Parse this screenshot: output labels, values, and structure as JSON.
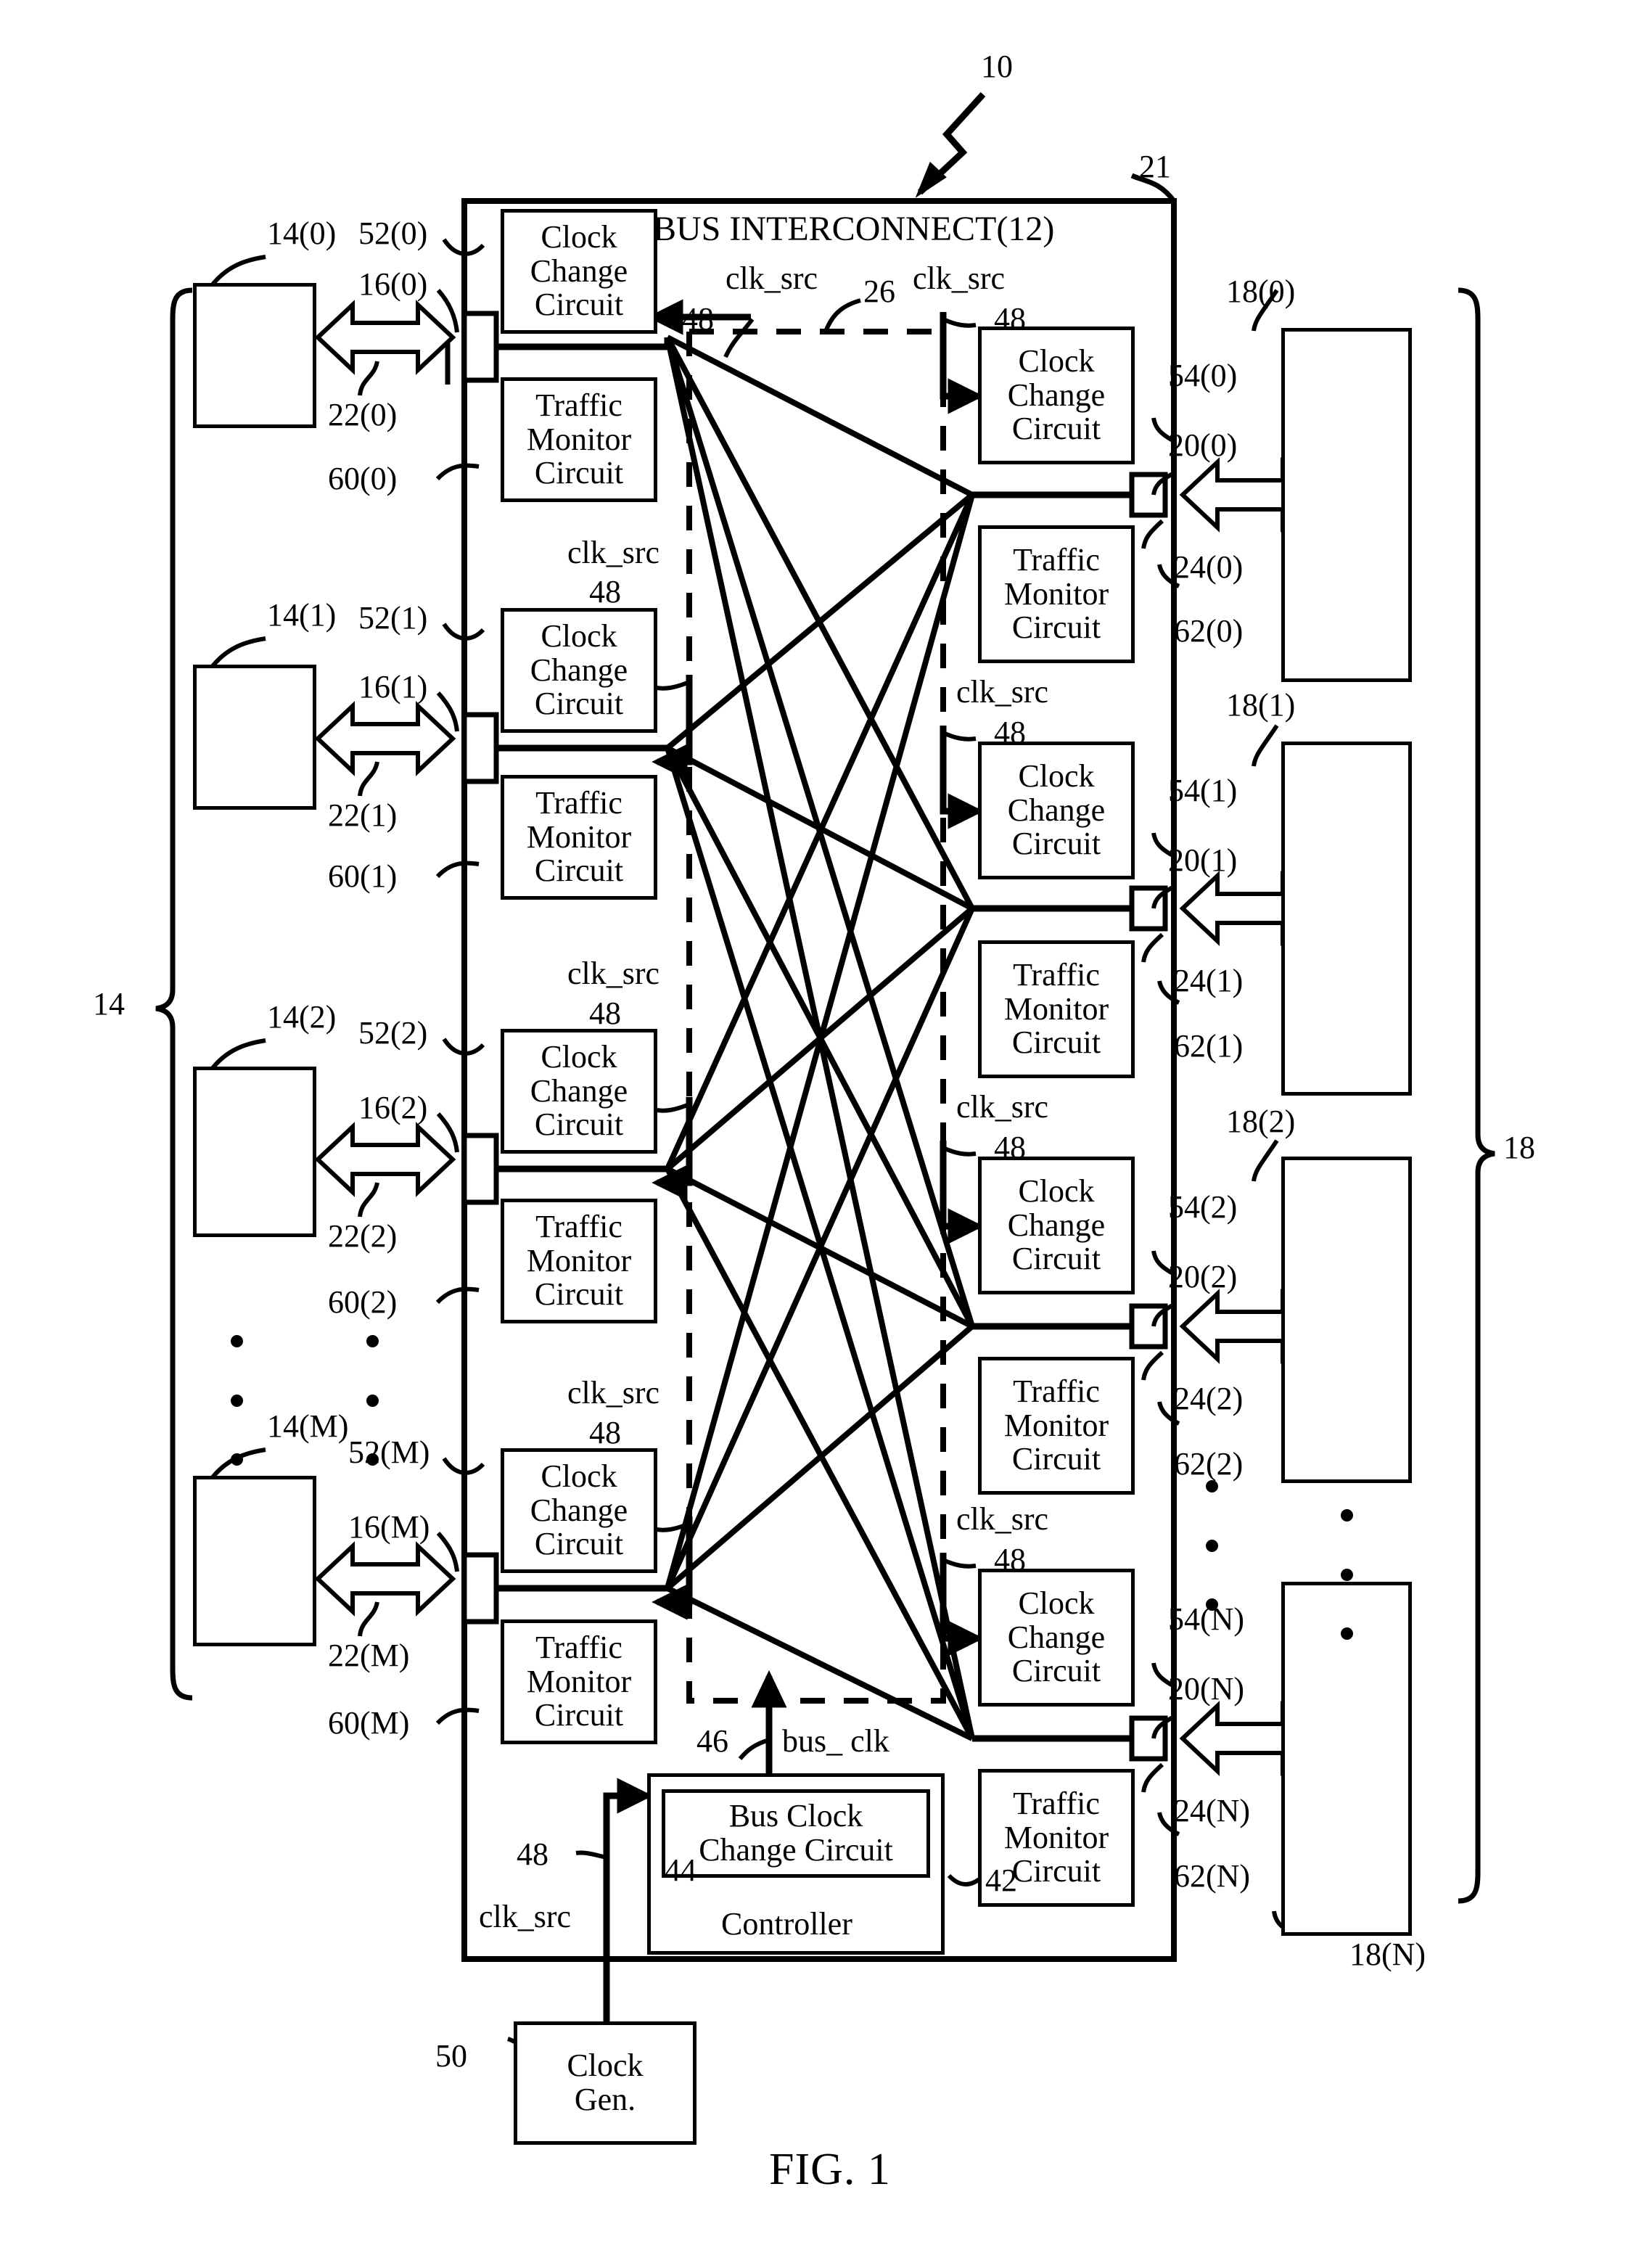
{
  "figure": {
    "caption": "FIG. 1",
    "system_ref": "10",
    "interconnect_boundary_ref": "21",
    "crossbar_region_ref": "26",
    "master_group_ref": "14",
    "slave_group_ref": "18"
  },
  "interconnect": {
    "title": "BUS INTERCONNECT(12)"
  },
  "labels": {
    "clk_src": "clk_src",
    "bus_clk": "bus_ clk",
    "clk_src_ref": "48",
    "bus_clk_ref": "46"
  },
  "blocks": {
    "clock_change": "Clock Change Circuit",
    "clock_change_lines": [
      "Clock",
      "Change",
      "Circuit"
    ],
    "traffic_monitor": "Traffic Monitor Circuit",
    "traffic_monitor_lines": [
      "Traffic",
      "Monitor",
      "Circuit"
    ],
    "bus_clock_change": "Bus Clock Change Circuit",
    "bus_clock_change_lines": [
      "Bus Clock",
      "Change Circuit"
    ],
    "controller": "Controller",
    "clock_gen_lines": [
      "Clock",
      "Gen."
    ],
    "controller_ref": "42",
    "bus_clock_change_ref": "44",
    "clock_gen_ref": "50"
  },
  "masters": [
    {
      "device_ref": "14(0)",
      "clock_port_ref": "52(0)",
      "iface_ref": "16(0)",
      "bus_ref": "22(0)",
      "monitor_ref": "60(0)"
    },
    {
      "device_ref": "14(1)",
      "clock_port_ref": "52(1)",
      "iface_ref": "16(1)",
      "bus_ref": "22(1)",
      "monitor_ref": "60(1)"
    },
    {
      "device_ref": "14(2)",
      "clock_port_ref": "52(2)",
      "iface_ref": "16(2)",
      "bus_ref": "22(2)",
      "monitor_ref": "60(2)"
    },
    {
      "device_ref": "14(M)",
      "clock_port_ref": "52(M)",
      "iface_ref": "16(M)",
      "bus_ref": "22(M)",
      "monitor_ref": "60(M)"
    }
  ],
  "slaves": [
    {
      "device_ref": "18(0)",
      "clock_port_ref": "54(0)",
      "iface_ref": "20(0)",
      "bus_ref": "24(0)",
      "monitor_ref": "62(0)"
    },
    {
      "device_ref": "18(1)",
      "clock_port_ref": "54(1)",
      "iface_ref": "20(1)",
      "bus_ref": "24(1)",
      "monitor_ref": "62(1)"
    },
    {
      "device_ref": "18(2)",
      "clock_port_ref": "54(2)",
      "iface_ref": "20(2)",
      "bus_ref": "24(2)",
      "monitor_ref": "62(2)"
    },
    {
      "device_ref": "18(N)",
      "clock_port_ref": "54(N)",
      "iface_ref": "20(N)",
      "bus_ref": "24(N)",
      "monitor_ref": "62(N)"
    }
  ]
}
